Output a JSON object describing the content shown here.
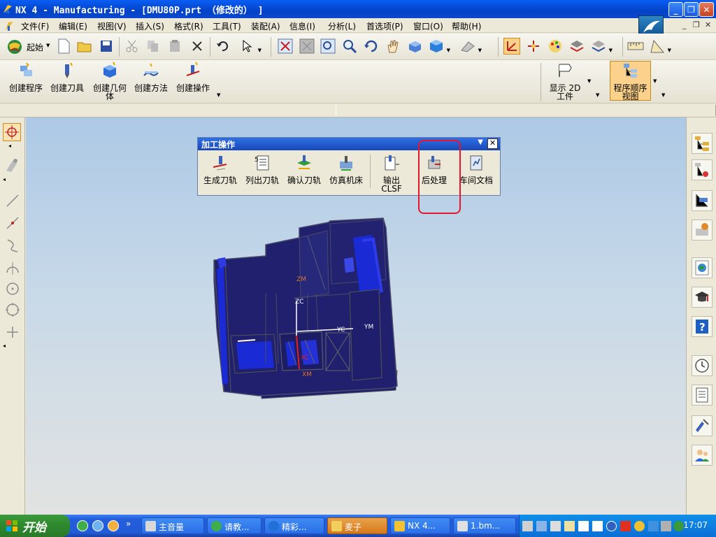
{
  "window": {
    "title": "NX 4 - Manufacturing - [DMU80P.prt （修改的） ]",
    "min": "_",
    "restore": "❐",
    "close": "✕"
  },
  "menu": {
    "items": [
      "文件(F)",
      "编辑(E)",
      "视图(V)",
      "插入(S)",
      "格式(R)",
      "工具(T)",
      "装配(A)",
      "信息(I)",
      "分析(L)",
      "首选项(P)",
      "窗口(O)",
      "帮助(H)"
    ],
    "doc_min": "_",
    "doc_restore": "❐",
    "doc_close": "✕"
  },
  "toolbar": {
    "start_label": "起始"
  },
  "create_toolbar": {
    "create_program": "创建程序",
    "create_tool": "创建刀具",
    "create_geometry": "创建几何\n体",
    "create_method": "创建方法",
    "create_operation": "创建操作",
    "show_2d": "显示 2D\n工件",
    "program_order_view": "程序顺序\n视图"
  },
  "dialog": {
    "title": "加工操作",
    "generate_path": "生成刀轨",
    "list_path": "列出刀轨",
    "verify_path": "确认刀轨",
    "simulate_machine": "仿真机床",
    "output_clsf": "输出\nCLSF",
    "postprocess": "后处理",
    "shop_doc": "车间文档"
  },
  "viewport": {
    "axes": {
      "zm": "ZM",
      "zc": "ZC",
      "yc": "YC",
      "ym": "YM",
      "xc": "XC",
      "xm": "XM"
    },
    "colors": {
      "model_dark": "#20206e",
      "model_bright": "#1a2bd6",
      "axis_white": "#ffffff",
      "axis_red": "#e02020"
    }
  },
  "taskbar": {
    "start": "开始",
    "quick_more": "»",
    "tasks": [
      "主音量",
      "请教...",
      "精彩...",
      "麦子",
      "NX 4...",
      "1.bm..."
    ],
    "clock": "17:07"
  }
}
